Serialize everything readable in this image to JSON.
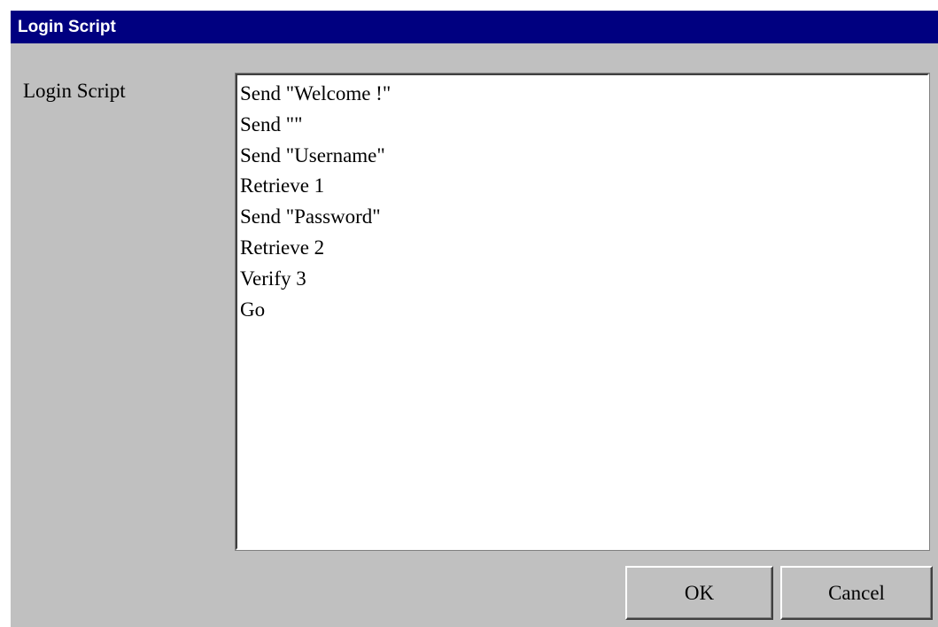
{
  "window": {
    "title": "Login Script"
  },
  "form": {
    "label": "Login Script",
    "script_lines": [
      "Send \"Welcome !\"",
      "Send \"\"",
      "Send \"Username\"",
      "Retrieve 1",
      "Send \"Password\"",
      "Retrieve 2",
      "Verify 3",
      "Go"
    ]
  },
  "buttons": {
    "ok_label": "OK",
    "cancel_label": "Cancel"
  },
  "colors": {
    "titlebar": "#000080",
    "dialog_background": "#c0c0c0",
    "field_background": "#ffffff"
  }
}
